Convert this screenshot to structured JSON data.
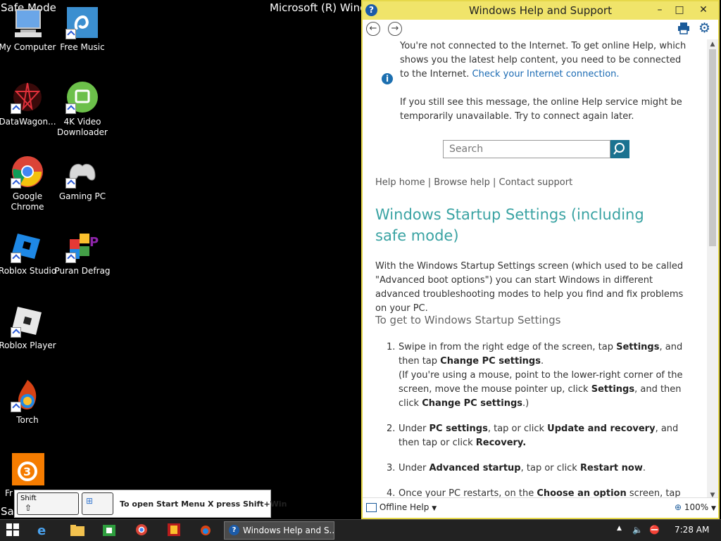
{
  "desktop": {
    "mode_top_left": "Safe Mode",
    "mode_bottom_left": "Safe",
    "os_title_partial": "Microsoft (R) Windo",
    "icons": [
      {
        "label": "My Computer",
        "icon": "computer-icon"
      },
      {
        "label": "Free Music",
        "icon": "music-icon"
      },
      {
        "label": "DataWagon...",
        "icon": "datawagon-icon"
      },
      {
        "label": "4K Video Downloader",
        "icon": "cloud-download-icon"
      },
      {
        "label": "Google Chrome",
        "icon": "chrome-icon"
      },
      {
        "label": "Gaming PC",
        "icon": "gamepad-icon"
      },
      {
        "label": "Roblox Studio",
        "icon": "roblox-studio-icon"
      },
      {
        "label": "Puran Defrag",
        "icon": "defrag-icon"
      },
      {
        "label": "Roblox Player",
        "icon": "roblox-icon"
      },
      {
        "label": "Torch",
        "icon": "torch-icon"
      },
      {
        "label": "Fr",
        "icon": "freemake-icon"
      }
    ]
  },
  "help_window": {
    "title": "Windows Help and Support",
    "window_controls": [
      "–",
      "□",
      "✕"
    ],
    "offline_msg": {
      "p1": "You're not connected to the Internet. To get online Help, which shows you the latest help content, you need to be connected to the Internet.",
      "link": "Check your Internet connection.",
      "p2": "If you still see this message, the online Help service might be temporarily unavailable. Try to connect again later."
    },
    "search_placeholder": "Search",
    "nav": {
      "home": "Help home",
      "browse": "Browse help",
      "contact": "Contact support",
      "sep": "|"
    },
    "heading": "Windows Startup Settings (including safe mode)",
    "intro": "With the Windows Startup Settings screen (which used to be called \"Advanced boot options\") you can start Windows in different advanced troubleshooting modes to help you find and fix problems on your PC.",
    "subheading": "To get to Windows Startup Settings",
    "steps": {
      "s1": {
        "num": "1.",
        "a": "Swipe in from the right edge of the screen, tap ",
        "b1": "Settings",
        "c": ", and then tap ",
        "b2": "Change PC settings",
        "d": ".",
        "e": "(If you're using a mouse, point to the lower-right corner of the screen, move the mouse pointer up, click ",
        "b3": "Settings",
        "f": ", and then click ",
        "b4": "Change PC settings",
        "g": ".)"
      },
      "s2": {
        "num": "2.",
        "a": "Under ",
        "b1": "PC settings",
        "c": ", tap or click ",
        "b2": "Update and recovery",
        "d": ", and then tap or click ",
        "b3": "Recovery.",
        "e": ""
      },
      "s3": {
        "num": "3.",
        "a": "Under ",
        "b1": "Advanced startup",
        "c": ", tap or click ",
        "b2": "Restart now",
        "d": "."
      },
      "s4": {
        "num": "4.",
        "a": "Once your PC restarts, on the ",
        "b1": "Choose an option",
        "c": " screen, tap or click"
      }
    },
    "status": {
      "offline": "Offline Help",
      "zoom": "100%"
    }
  },
  "keyboard_hint": {
    "shift_key": "Shift",
    "shift_arrow": "⇧",
    "text": "To open Start Menu X press Shift+Win"
  },
  "taskbar": {
    "active_task": "Windows Help and S...",
    "time": "7:28 AM"
  }
}
